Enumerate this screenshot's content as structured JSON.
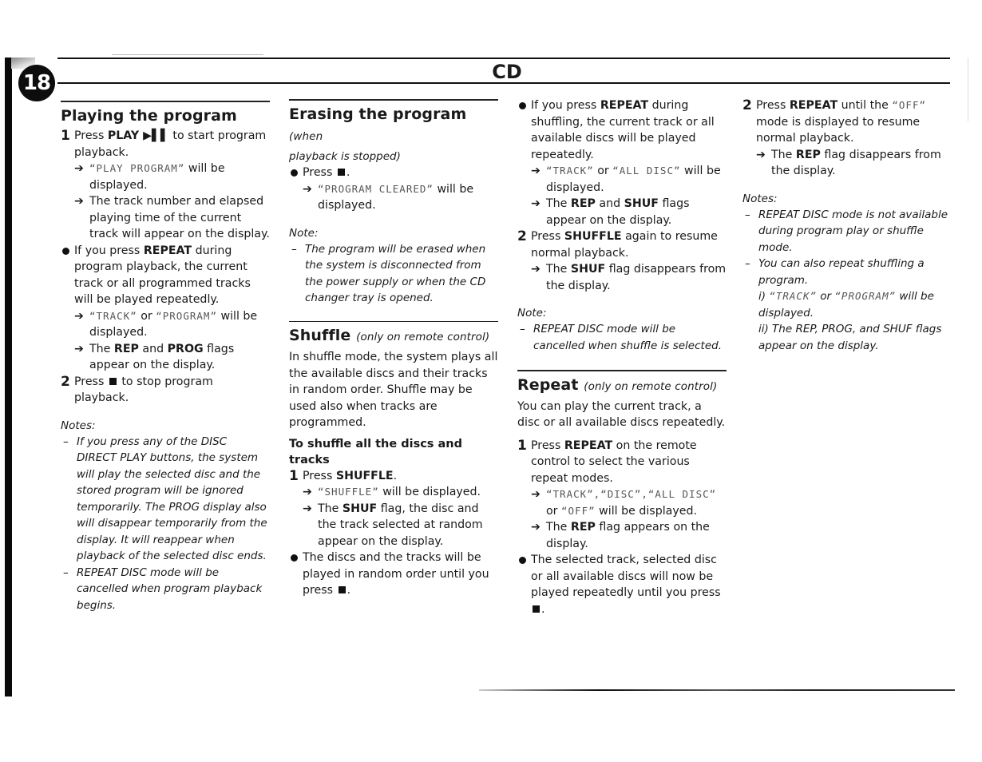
{
  "page": {
    "number": "18",
    "chapter": "CD"
  },
  "col1": {
    "title": "Playing the program",
    "step1": {
      "num": "1",
      "pre": "Press ",
      "bold": "PLAY ▶▌▌",
      "post": " to start program playback."
    },
    "step1_arrow1": {
      "lcd": "“PLAY PROGRAM”",
      "post": " will be displayed."
    },
    "step1_arrow2": "The track number and elapsed playing time of the current track will appear on the display.",
    "bullet1": {
      "pre": "If you press ",
      "bold": "REPEAT",
      "post": " during program playback, the current track or all programmed tracks will be played repeatedly."
    },
    "bullet1_arrow1": {
      "lcd1": "“TRACK”",
      "mid": " or ",
      "lcd2": "“PROGRAM”",
      "post": " will be displayed."
    },
    "bullet1_arrow2": {
      "pre": "The ",
      "b1": "REP",
      "mid": " and ",
      "b2": "PROG",
      "post": " flags appear on the display."
    },
    "step2": {
      "num": "2",
      "pre": "Press ",
      "post": " to stop program playback."
    },
    "notes_head": "Notes:",
    "notes": [
      "If you press any of the DISC DIRECT PLAY buttons, the system will play the selected disc and the stored program will be ignored temporarily. The PROG display also will disappear temporarily from the display. It will reappear when playback of the selected disc ends.",
      "REPEAT DISC mode will be cancelled when program playback begins."
    ]
  },
  "col2": {
    "erase_title": "Erasing the program",
    "erase_sub": "(when",
    "erase_sub2": "playback is stopped)",
    "erase_bullet": "Press",
    "erase_arrow": {
      "lcd": "“PROGRAM CLEARED”",
      "post": " will be displayed."
    },
    "note_head": "Note:",
    "note": "The program will be erased when the system is disconnected from the power supply or when the CD changer tray is opened.",
    "shuffle_title": "Shuffle",
    "shuffle_sub": "(only on remote control)",
    "shuffle_intro": "In shuffle mode, the system plays all the available discs and their tracks in random order. Shuffle may be used also when tracks are programmed.",
    "shuffle_h3": "To shuffle all the discs and tracks",
    "step1": {
      "num": "1",
      "pre": "Press ",
      "bold": "SHUFFLE",
      "post": "."
    },
    "step1_arrow1": {
      "lcd": "“SHUFFLE”",
      "post": " will be displayed."
    },
    "step1_arrow2": {
      "pre": "The ",
      "bold": "SHUF",
      "post": " flag, the disc and the track selected at random appear on the display."
    },
    "bullet": "The discs and the tracks will be played in random order until you press"
  },
  "col3": {
    "bullet1": {
      "pre": "If you press ",
      "bold": "REPEAT",
      "post": " during shuffling, the current track or all available discs will be played repeatedly."
    },
    "bullet1_arrow1": {
      "lcd1": "“TRACK”",
      "mid": " or ",
      "lcd2": "“ALL DISC”",
      "post": " will be displayed."
    },
    "bullet1_arrow2": {
      "pre": "The ",
      "b1": "REP",
      "mid": " and ",
      "b2": "SHUF",
      "post": " flags appear on the display."
    },
    "step2": {
      "num": "2",
      "pre": "Press ",
      "bold": "SHUFFLE",
      "post": " again to resume normal playback."
    },
    "step2_arrow": {
      "pre": "The ",
      "bold": "SHUF",
      "post": " flag disappears from the display."
    },
    "note_head": "Note:",
    "note": "REPEAT DISC mode will be cancelled when shuffle is selected.",
    "repeat_title": "Repeat",
    "repeat_sub": "(only on remote control)",
    "repeat_intro": "You can play the current track, a disc or all available discs repeatedly.",
    "step1": {
      "num": "1",
      "pre": "Press ",
      "bold": "REPEAT",
      "post": " on the remote control to select the various repeat modes."
    },
    "step1_arrow1": {
      "lcd1": "“TRACK”,“DISC”,“ALL DISC”",
      "mid": " or ",
      "lcd2": "“OFF”",
      "post": " will be displayed."
    },
    "step1_arrow2": {
      "pre": "The ",
      "bold": "REP",
      "post": " flag appears on the display."
    },
    "bullet2": "The selected track, selected disc or all available discs will now be played repeatedly until you press"
  },
  "col4": {
    "step2": {
      "num": "2",
      "pre": "Press ",
      "bold": "REPEAT",
      "mid": " until the ",
      "lcd": "“OFF”",
      "post": " mode is displayed to resume normal playback."
    },
    "step2_arrow": {
      "pre": "The ",
      "bold": "REP",
      "post": " flag disappears from the display."
    },
    "notes_head": "Notes:",
    "note1": "REPEAT DISC mode is not available during program play or shuffle mode.",
    "note2": "You can also repeat shuffling a program.",
    "note2_i": {
      "pre": "i) ",
      "lcd1": "“TRACK”",
      "mid": " or ",
      "lcd2": "“PROGRAM”",
      "post": " will be displayed."
    },
    "note2_ii": "ii) The REP, PROG, and SHUF flags appear on the display."
  },
  "symbols": {
    "arrow": "➔",
    "dash": "–"
  }
}
